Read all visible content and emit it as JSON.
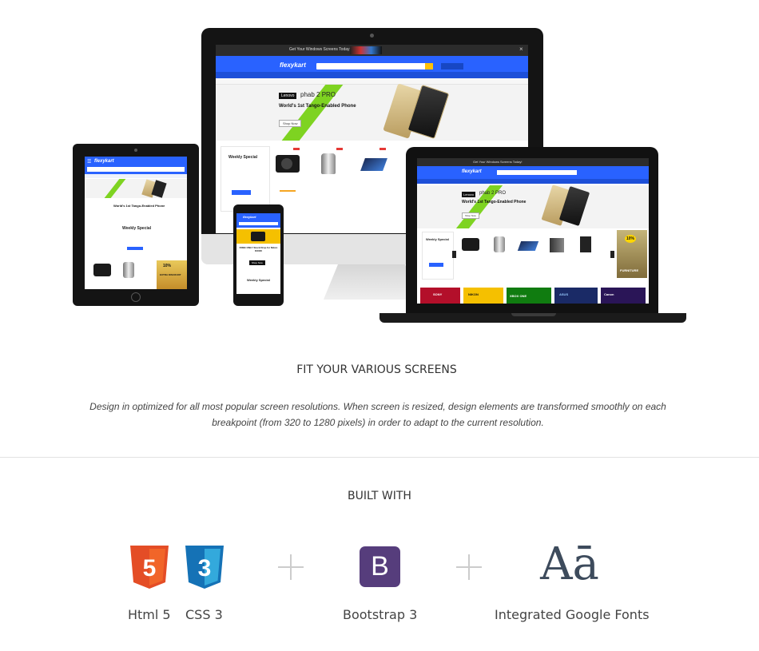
{
  "showcase": {
    "desktop": {
      "announce": "Get Your Windows Screens Today!",
      "logo": "flexykart",
      "hero_brand": "Lenovo",
      "hero_model": "phab 2 PRO",
      "hero_title": "World's 1st Tango-Enabled Phone",
      "hero_button": "Shop Now",
      "weekly_title": "Weekly Special"
    },
    "laptop": {
      "announce": "Get Your Windows Screens Today!",
      "logo": "flexykart",
      "hero_brand": "Lenovo",
      "hero_model": "phab 2 PRO",
      "hero_title": "World's 1st Tango-Enabled Phone",
      "hero_button": "Shop Now",
      "weekly_title": "Weekly Special",
      "promo_pct": "10%",
      "promo_word": "FURNITURE",
      "brands": [
        "SONY",
        "NIKON",
        "XBOX ONE",
        "ASUS",
        "Canon"
      ]
    },
    "tablet": {
      "logo": "flexykart",
      "hero_title": "World's 1st Tango-Enabled Phone",
      "weekly_title": "Weekly Special",
      "promo_pct": "10%",
      "promo_text": "EXTRA DISCOUNT"
    },
    "phone": {
      "logo": "flexykart",
      "hero_title": "FREE ONLY Stock Drop for Nikon D3400",
      "button": "Shop Now",
      "weekly_title": "Weekly Special"
    }
  },
  "screens_section": {
    "heading": "FIT YOUR VARIOUS SCREENS",
    "description": "Design in optimized for all most popular screen resolutions. When screen is resized, design elements are transformed smoothly on each breakpoint (from 320 to 1280 pixels) in order to adapt to the current resolution."
  },
  "built_section": {
    "heading": "BUILT WITH",
    "html_badge": "5",
    "css_badge": "3",
    "bootstrap_badge": "B",
    "fonts_badge": "Aā",
    "labels": {
      "html": "Html 5",
      "css": "CSS 3",
      "bootstrap": "Bootstrap 3",
      "fonts": "Integrated Google Fonts"
    },
    "colors": {
      "html": "#e44d26",
      "css": "#1572b6",
      "bootstrap": "#563d7c",
      "fonts": "#3d4b5c"
    }
  }
}
